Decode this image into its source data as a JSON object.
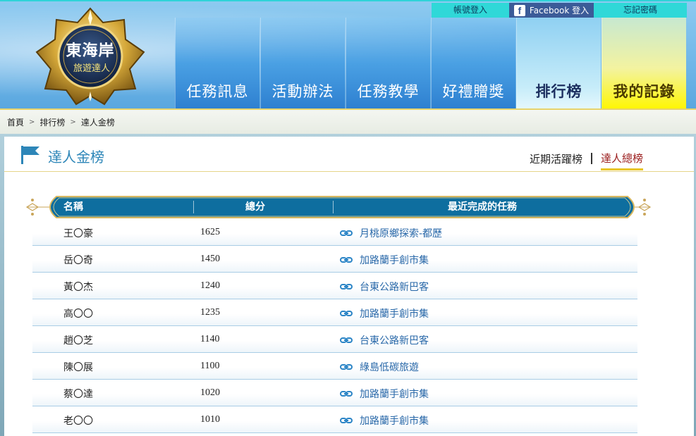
{
  "brand": {
    "logo_line1": "東海岸",
    "logo_line2": "旅遊達人"
  },
  "top_links": {
    "account_login": "帳號登入",
    "facebook_login": "Facebook 登入",
    "forgot_password": "忘記密碼",
    "facebook_icon_glyph": "f"
  },
  "nav": {
    "items": [
      {
        "label": "任務訊息"
      },
      {
        "label": "活動辦法"
      },
      {
        "label": "任務教學"
      },
      {
        "label": "好禮贈獎"
      },
      {
        "label": "排行榜"
      },
      {
        "label": "我的記錄"
      }
    ]
  },
  "breadcrumb": {
    "home": "首頁",
    "ranking": "排行榜",
    "current": "達人金榜",
    "separator": ">"
  },
  "page": {
    "title": "達人金榜",
    "tabs": {
      "recent": "近期活躍榜",
      "total": "達人總榜"
    }
  },
  "table": {
    "headers": {
      "name": "名稱",
      "score": "總分",
      "task": "最近完成的任務"
    },
    "rows": [
      {
        "name": "王〇豪",
        "score": "1625",
        "task": "月桃原鄉探索-都歷"
      },
      {
        "name": "岳〇奇",
        "score": "1450",
        "task": "加路蘭手創市集"
      },
      {
        "name": "黃〇杰",
        "score": "1240",
        "task": "台東公路新巴客"
      },
      {
        "name": "高〇〇",
        "score": "1235",
        "task": "加路蘭手創市集"
      },
      {
        "name": "趙〇芝",
        "score": "1140",
        "task": "台東公路新巴客"
      },
      {
        "name": "陳〇展",
        "score": "1100",
        "task": "綠島低碳旅遊"
      },
      {
        "name": "蔡〇達",
        "score": "1020",
        "task": "加路蘭手創市集"
      },
      {
        "name": "老〇〇",
        "score": "1010",
        "task": "加路蘭手創市集"
      }
    ]
  },
  "colors": {
    "accent_blue": "#2d86b8",
    "active_tab": "#9a1c1c",
    "gold": "#e8c42a",
    "header_bar": "#2fd8d8",
    "facebook": "#3b5b98"
  }
}
